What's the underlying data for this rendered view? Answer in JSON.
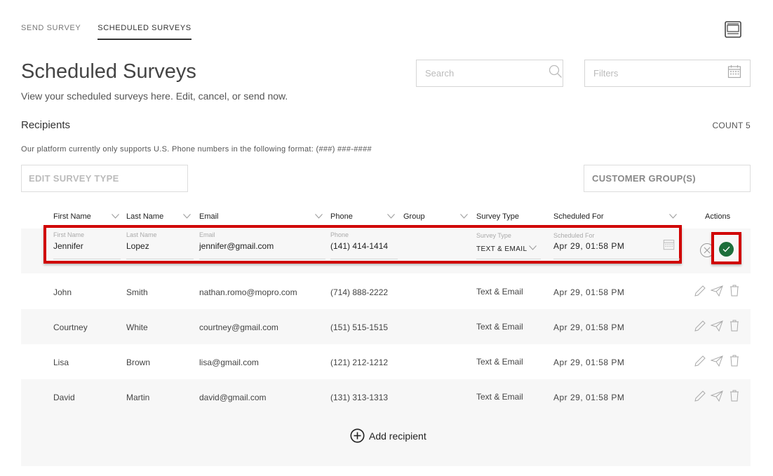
{
  "tabs": [
    {
      "label": "SEND SURVEY",
      "active": false
    },
    {
      "label": "SCHEDULED SURVEYS",
      "active": true
    }
  ],
  "header": {
    "title": "Scheduled Surveys",
    "subtitle": "View your scheduled surveys here. Edit, cancel, or send now.",
    "monitor_icon": "monitor-icon"
  },
  "search": {
    "placeholder": "Search",
    "icon": "search-icon"
  },
  "filters": {
    "placeholder": "Filters",
    "icon": "calendar-icon"
  },
  "recipients": {
    "label": "Recipients",
    "count_label": "COUNT 5",
    "notice": "Our platform currently only supports U.S. Phone numbers in the following format: (###) ###-####"
  },
  "controls": {
    "edit_survey_type": "EDIT SURVEY TYPE",
    "customer_groups": "CUSTOMER GROUP(S)"
  },
  "table": {
    "columns": [
      "First Name",
      "Last Name",
      "Email",
      "Phone",
      "Group",
      "Survey Type",
      "Scheduled For",
      "Actions"
    ],
    "edit_row": {
      "labels": {
        "first": "First Name",
        "last": "Last Name",
        "email": "Email",
        "phone": "Phone",
        "survey_type": "Survey Type",
        "scheduled": "Scheduled For"
      },
      "first": "Jennifer",
      "last": "Lopez",
      "email": "jennifer@gmail.com",
      "phone": "(141) 414-1414",
      "survey_type": "TEXT & EMAIL",
      "scheduled": "Apr 29, 01:58 PM"
    },
    "rows": [
      {
        "first": "John",
        "last": "Smith",
        "email": "nathan.romo@mopro.com",
        "phone": "(714) 888-2222",
        "group": "",
        "survey_type": "Text & Email",
        "scheduled": "Apr 29, 01:58 PM"
      },
      {
        "first": "Courtney",
        "last": "White",
        "email": "courtney@gmail.com",
        "phone": "(151) 515-1515",
        "group": "",
        "survey_type": "Text & Email",
        "scheduled": "Apr 29, 01:58 PM"
      },
      {
        "first": "Lisa",
        "last": "Brown",
        "email": "lisa@gmail.com",
        "phone": "(121) 212-1212",
        "group": "",
        "survey_type": "Text & Email",
        "scheduled": "Apr 29, 01:58 PM"
      },
      {
        "first": "David",
        "last": "Martin",
        "email": "david@gmail.com",
        "phone": "(131) 313-1313",
        "group": "",
        "survey_type": "Text & Email",
        "scheduled": "Apr 29, 01:58 PM"
      }
    ],
    "add_recipient": "Add recipient"
  },
  "colors": {
    "confirm_green": "#1d6e3b",
    "highlight_red": "#d00000",
    "row_stripe": "#f7f7f7"
  }
}
